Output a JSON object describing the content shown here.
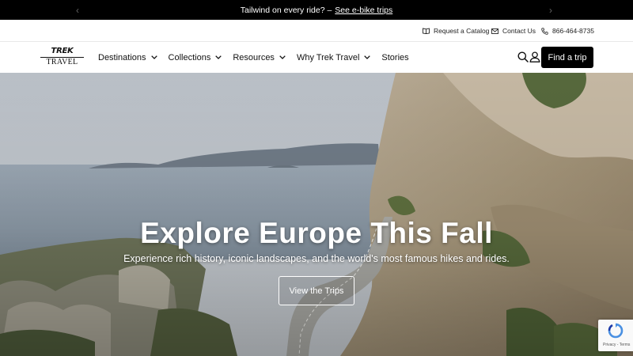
{
  "announcement": {
    "text": "Tailwind on every ride? –",
    "link": "See e-bike trips"
  },
  "utility": {
    "catalog": "Request a Catalog",
    "contact": "Contact Us",
    "phone": "866-464-8735"
  },
  "logo": {
    "top": "TREK",
    "bottom": "TRAVEL"
  },
  "nav": {
    "items": [
      {
        "label": "Destinations",
        "has_dropdown": true
      },
      {
        "label": "Collections",
        "has_dropdown": true
      },
      {
        "label": "Resources",
        "has_dropdown": true
      },
      {
        "label": "Why Trek Travel",
        "has_dropdown": true
      },
      {
        "label": "Stories",
        "has_dropdown": false
      }
    ],
    "cta": "Find a trip",
    "icons": [
      "search-icon",
      "user-icon"
    ]
  },
  "hero": {
    "title": "Explore Europe This Fall",
    "subtitle": "Experience rich history, iconic landscapes, and the world's most famous hikes and rides.",
    "button": "View the Trips"
  },
  "recaptcha": {
    "terms": "Privacy - Terms"
  },
  "colors": {
    "announcement_bg": "#000000",
    "cta_bg": "#000000",
    "text": "#111111"
  }
}
